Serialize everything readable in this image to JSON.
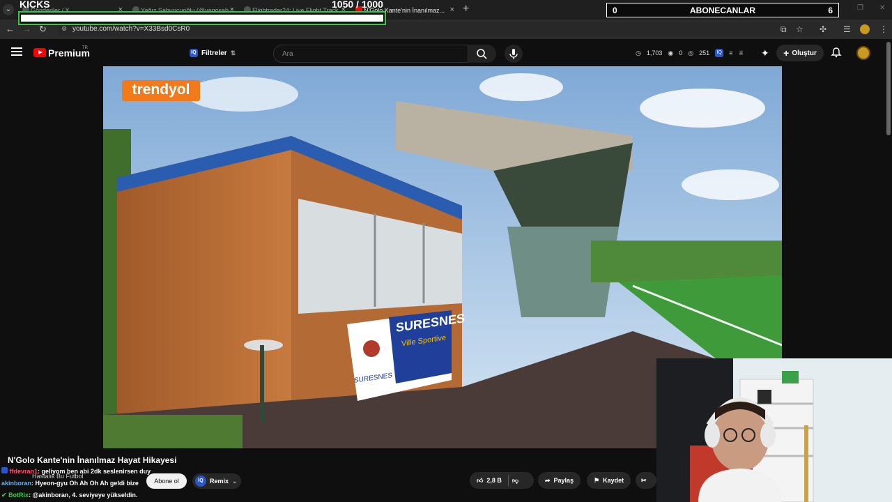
{
  "tabs": [
    {
      "label": "Gönderiler / X"
    },
    {
      "label": "Yağız Sabuncuoğlu (@yagosab..."
    },
    {
      "label": "Flightradar24: Live Flight Track..."
    },
    {
      "label": "N'Golo Kante'nin İnanılmaz..."
    }
  ],
  "overlay": {
    "kicks": "KICKS",
    "goal_current": "1050",
    "goal_sep": "/",
    "goal_target": "1000",
    "goal_fraction": 1.0,
    "abone_left": "0",
    "abone_title": "ABONECANLAR",
    "abone_right": "6"
  },
  "address": {
    "url": "youtube.com/watch?v=X33Bsd0CsR0"
  },
  "header": {
    "brand": "Premium",
    "region": "TR",
    "filters_label": "Filtreler",
    "search_placeholder": "Ara",
    "stat1": "1,703",
    "stat2": "0",
    "stat3": "251",
    "create_label": "Oluştur"
  },
  "video": {
    "sponsor": "trendyol",
    "banner_top": "SURESNES",
    "banner_sub": "Ville Sportive",
    "banner_bottom": "SURESNES"
  },
  "below": {
    "title": "N'Golo Kante'nin İnanılmaz Hayat Hikayesi",
    "channel": "Hastalık Bu Futbol",
    "subscribe": "Abone ol",
    "remix": "Remix",
    "likes": "2,8 B",
    "share": "Paylaş",
    "save": "Kaydet"
  },
  "chat": [
    {
      "user": "ffdevran1",
      "text": ": geliyom ben abi 2dk seslenirsen duy"
    },
    {
      "user": "akinboran",
      "text": ": Hyeon-gyu Oh Ah Oh Ah geldi bize"
    },
    {
      "user": "BotRix",
      "text": ": @akinboran, 4. seviyeye yükseldin."
    }
  ],
  "colors": {
    "accent_green": "#39c74a",
    "yt_red": "#ff0000",
    "bg": "#0f0f0f"
  }
}
